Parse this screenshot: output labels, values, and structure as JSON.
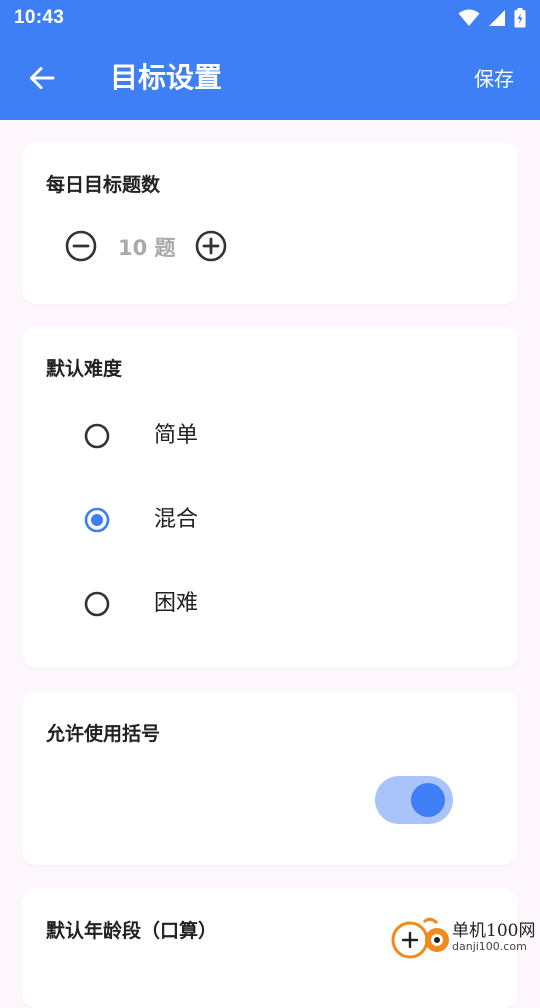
{
  "status_bar": {
    "time": "10:43"
  },
  "app_bar": {
    "title": "目标设置",
    "save_label": "保存"
  },
  "daily_goal": {
    "title": "每日目标题数",
    "value": "10 题"
  },
  "difficulty": {
    "title": "默认难度",
    "options": [
      {
        "label": "简单",
        "selected": false
      },
      {
        "label": "混合",
        "selected": true
      },
      {
        "label": "困难",
        "selected": false
      }
    ]
  },
  "brackets": {
    "title": "允许使用括号",
    "enabled": true
  },
  "age_group": {
    "title": "默认年龄段（口算）"
  },
  "watermark": {
    "brand": "单机100网",
    "domain": "danji100.com"
  },
  "colors": {
    "primary": "#3f7ff5",
    "toggle_track": "#a9c3fb",
    "muted_text": "#a9a9a9"
  }
}
